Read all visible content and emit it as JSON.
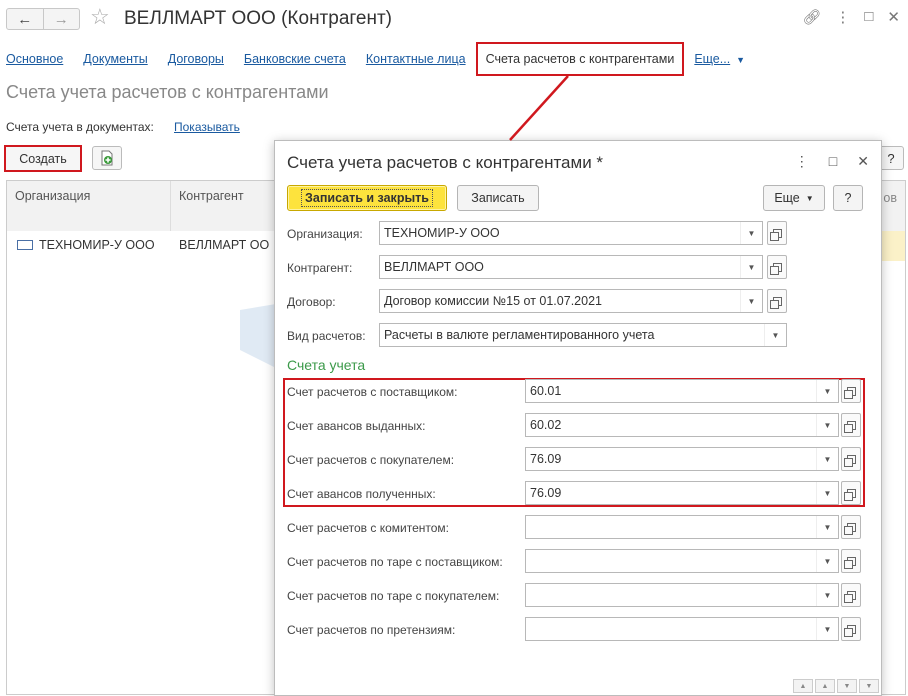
{
  "window": {
    "title": "ВЕЛЛМАРТ ООО (Контрагент)"
  },
  "tabs": [
    {
      "label": "Основное"
    },
    {
      "label": "Документы"
    },
    {
      "label": "Договоры"
    },
    {
      "label": "Банковские счета"
    },
    {
      "label": "Контактные лица"
    },
    {
      "label": "Счета расчетов с контрагентами"
    }
  ],
  "tabs_more": "Еще...",
  "page": {
    "title": "Счета учета расчетов с контрагентами",
    "accounts_label": "Счета учета в документах:",
    "accounts_link": "Показывать",
    "create_button": "Создать",
    "help": "?"
  },
  "table": {
    "columns": [
      "Организация",
      "Контрагент",
      "ов"
    ],
    "rows": [
      {
        "org": "ТЕХНОМИР-У ООО",
        "contractor": "ВЕЛЛМАРТ ОО"
      }
    ]
  },
  "dialog": {
    "title": "Счета учета расчетов с контрагентами *",
    "save_close": "Записать и закрыть",
    "save": "Записать",
    "more": "Еще",
    "help": "?",
    "fields": {
      "organization": {
        "label": "Организация:",
        "value": "ТЕХНОМИР-У ООО"
      },
      "contractor": {
        "label": "Контрагент:",
        "value": "ВЕЛЛМАРТ ООО"
      },
      "contract": {
        "label": "Договор:",
        "value": "Договор комиссии №15 от 01.07.2021"
      },
      "settlement_type": {
        "label": "Вид расчетов:",
        "value": "Расчеты в валюте регламентированного учета"
      }
    },
    "group_title": "Счета учета",
    "accounts": [
      {
        "label": "Счет расчетов с поставщиком:",
        "value": "60.01"
      },
      {
        "label": "Счет авансов выданных:",
        "value": "60.02"
      },
      {
        "label": "Счет расчетов с покупателем:",
        "value": "76.09"
      },
      {
        "label": "Счет авансов полученных:",
        "value": "76.09"
      },
      {
        "label": "Счет расчетов с комитентом:",
        "value": ""
      },
      {
        "label": "Счет расчетов по таре с поставщиком:",
        "value": ""
      },
      {
        "label": "Счет расчетов по таре с покупателем:",
        "value": ""
      },
      {
        "label": "Счет расчетов по претензиям:",
        "value": ""
      }
    ]
  },
  "colors": {
    "highlight": "#d0181e",
    "primary_button": "#fde33d",
    "link": "#1a5aa0",
    "group_title": "#3c9a4a"
  }
}
